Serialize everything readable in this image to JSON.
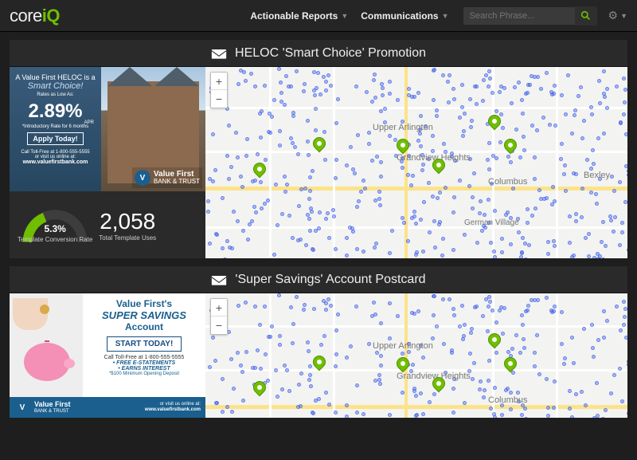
{
  "brand": {
    "part1": "core",
    "part2": "iQ"
  },
  "nav": {
    "reports": "Actionable Reports",
    "comms": "Communications"
  },
  "search": {
    "placeholder": "Search Phrase..."
  },
  "cards": [
    {
      "title": "HELOC 'Smart Choice' Promotion",
      "promo": {
        "line1": "A Value First HELOC is a",
        "line2": "Smart Choice!",
        "rates_label": "Rates as Low As:",
        "rate": "2.89%",
        "apr": "APR",
        "intro": "*Introductory Rate for 6 months",
        "apply": "Apply Today!",
        "toll": "Call Toll-Free at 1-800-555-5555",
        "visit": "or visit us online at:",
        "url": "www.valuefirstbank.com",
        "brand1": "Value First",
        "brand2": "BANK & TRUST"
      },
      "gauge": {
        "value": "5.3%",
        "label": "Template Conversion Rate"
      },
      "total": {
        "value": "2,058",
        "label": "Total Template Uses"
      },
      "map_labels": {
        "upper_arlington": "Upper Arlington",
        "grandview": "Grandview Heights",
        "columbus": "Columbus",
        "bexley": "Bexley",
        "german_village": "German Village"
      }
    },
    {
      "title": "'Super Savings' Account Postcard",
      "promo": {
        "vf": "Value First's",
        "ss": "SUPER SAVINGS",
        "acc": "Account",
        "start": "START TODAY!",
        "toll": "Call Toll-Free at 1-800-555-5555",
        "feat1": "• FREE E-STATEMENTS",
        "feat2": "• EARNS INTEREST",
        "min": "*$100 Minimum Opening Deposit",
        "brand1": "Value First",
        "brand2": "BANK & TRUST",
        "visit": "or visit us online at:",
        "url": "www.valuefirstbank.com"
      },
      "map_labels": {
        "upper_arlington": "Upper Arlington",
        "grandview": "Grandview Heights",
        "columbus": "Columbus"
      }
    }
  ],
  "zoom": {
    "in": "+",
    "out": "−"
  }
}
